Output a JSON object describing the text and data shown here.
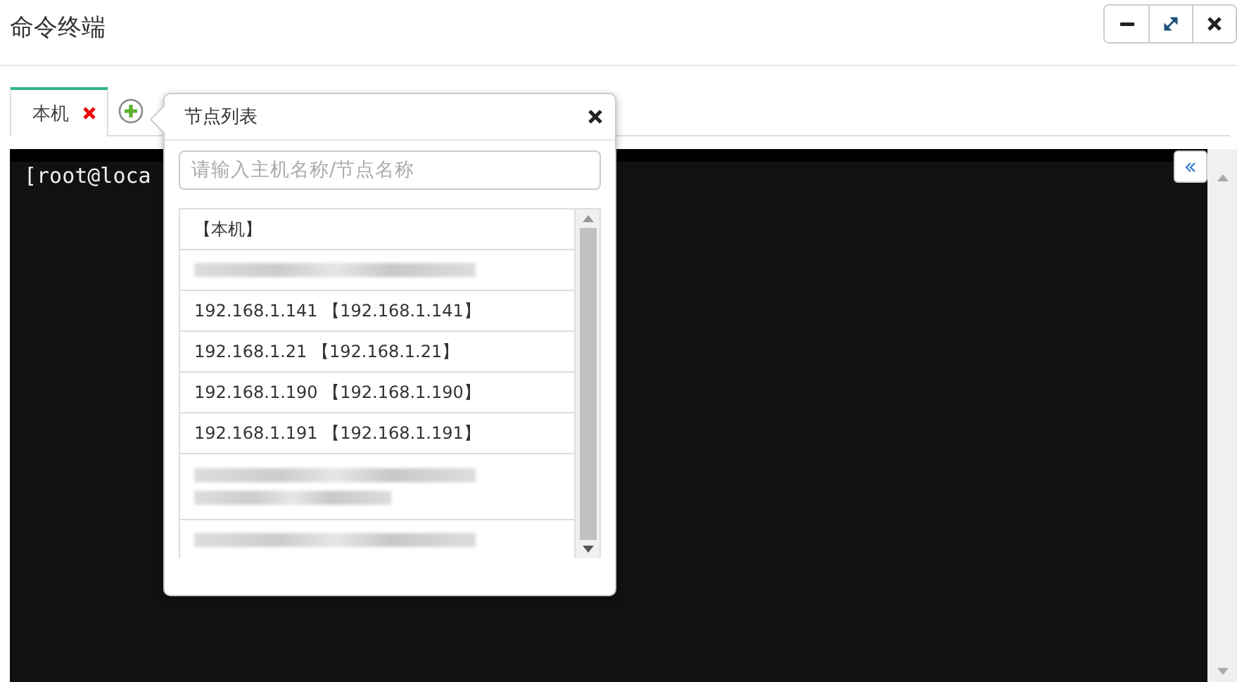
{
  "window": {
    "title": "命令终端"
  },
  "tabs": [
    {
      "label": "本机",
      "selected": true,
      "closable": true
    }
  ],
  "terminal": {
    "text": "[root@loca"
  },
  "node_popover": {
    "title": "节点列表",
    "search": {
      "placeholder": "请输入主机名称/节点名称"
    },
    "items": [
      {
        "kind": "host",
        "label": "【本机】"
      },
      {
        "kind": "masked",
        "wrap": false
      },
      {
        "kind": "host",
        "label": "192.168.1.141 【192.168.1.141】"
      },
      {
        "kind": "host",
        "label": "192.168.1.21 【192.168.1.21】"
      },
      {
        "kind": "host",
        "label": "192.168.1.190 【192.168.1.190】"
      },
      {
        "kind": "host",
        "label": "192.168.1.191 【192.168.1.191】"
      },
      {
        "kind": "masked",
        "wrap": true
      },
      {
        "kind": "masked",
        "wrap": false
      }
    ]
  }
}
